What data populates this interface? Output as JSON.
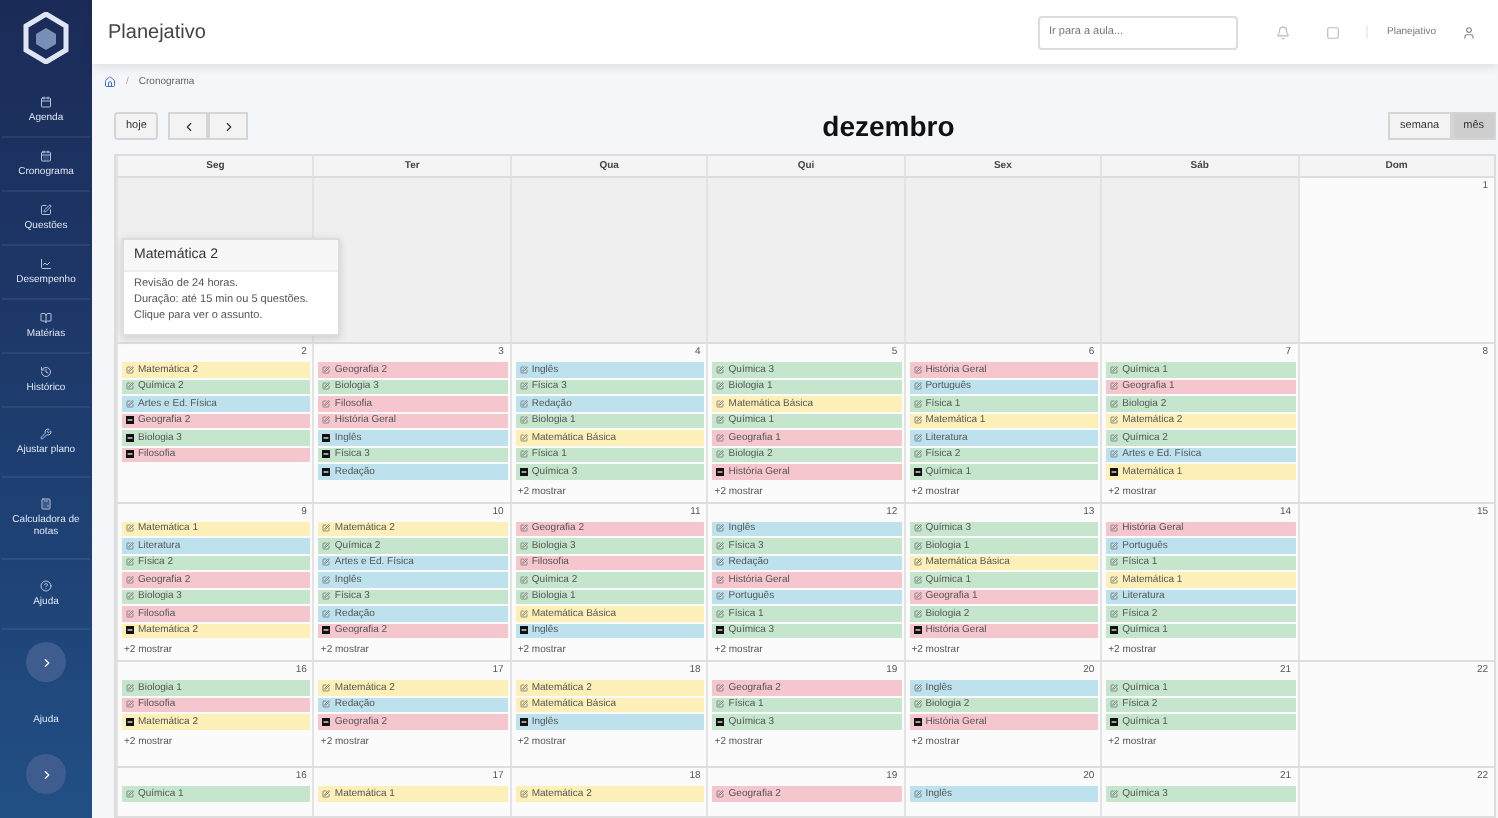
{
  "sidebar": {
    "items": [
      {
        "label": "Agenda",
        "kind": "link"
      },
      {
        "label": "Cronograma",
        "kind": "link"
      },
      {
        "label": "Questões",
        "kind": "link"
      },
      {
        "label": "Desempenho",
        "kind": "link"
      },
      {
        "label": "Matérias",
        "kind": "link"
      },
      {
        "label": "Histórico",
        "kind": "link"
      },
      {
        "label": "Ajustar plano",
        "kind": "link"
      },
      {
        "label": "Calculadora de notas",
        "kind": "link"
      },
      {
        "label": "Ajuda",
        "kind": "link"
      },
      {
        "kind": "toggle"
      },
      {
        "label": "Ajuda",
        "kind": "plain"
      },
      {
        "kind": "toggle"
      }
    ]
  },
  "topbar": {
    "title": "Planejativo",
    "search": {
      "placeholder": "Ir para a aula..."
    },
    "user": "Planejativo"
  },
  "breadcrumb": [
    {
      "kind": "separator",
      "text": "/"
    },
    {
      "kind": "item",
      "text": "Cronograma"
    }
  ],
  "toolbar": {
    "today": "hoje",
    "month": "dezembro",
    "views": [
      {
        "label": "semana",
        "selected": false
      },
      {
        "label": "mês",
        "selected": true
      }
    ]
  },
  "tooltip": {
    "title": "Matemática 2",
    "lines": [
      "Revisão de 24 horas.",
      "Duração: até 15 min ou 5 questões.",
      "Clique para ver o assunto."
    ]
  },
  "calendar": {
    "weekdays": [
      "Seg",
      "Ter",
      "Qua",
      "Qui",
      "Sex",
      "Sáb",
      "Dom"
    ],
    "weeks": [
      {
        "days": [
          {
            "outside": true
          },
          {
            "outside": true
          },
          {
            "outside": true
          },
          {
            "outside": true
          },
          {
            "outside": true
          },
          {
            "outside": true
          },
          {
            "outside": false,
            "date": "1"
          }
        ]
      },
      {
        "days": [
          {
            "outside": false,
            "date": "2",
            "events": [
              {
                "title": "Matemática 2",
                "kind": "pending",
                "color": "#fcefb8"
              },
              {
                "title": "Química 2",
                "kind": "pending",
                "color": "#c5e6cd"
              },
              {
                "title": "Artes e Ed. Física",
                "kind": "pending",
                "color": "#bde2ee"
              },
              {
                "title": "Geografia 2",
                "kind": "done",
                "color": "#f5c6cd"
              },
              {
                "title": "Biologia 3",
                "kind": "done",
                "color": "#c5e6cd"
              },
              {
                "title": "Filosofia",
                "kind": "done",
                "color": "#f5c6cd"
              }
            ]
          },
          {
            "outside": false,
            "date": "3",
            "events": [
              {
                "title": "Geografia 2",
                "kind": "pending",
                "color": "#f5c6cd"
              },
              {
                "title": "Biologia 3",
                "kind": "pending",
                "color": "#c5e6cd"
              },
              {
                "title": "Filosofia",
                "kind": "pending",
                "color": "#f5c6cd"
              },
              {
                "title": "História Geral",
                "kind": "pending",
                "color": "#f5c6cd"
              },
              {
                "title": "Inglês",
                "kind": "done",
                "color": "#bde2ee"
              },
              {
                "title": "Física 3",
                "kind": "done",
                "color": "#c5e6cd"
              },
              {
                "title": "Redação",
                "kind": "done",
                "color": "#bde2ee"
              }
            ]
          },
          {
            "outside": false,
            "date": "4",
            "more": "+2 mostrar",
            "events": [
              {
                "title": "Inglês",
                "kind": "pending",
                "color": "#bde2ee"
              },
              {
                "title": "Física 3",
                "kind": "pending",
                "color": "#c5e6cd"
              },
              {
                "title": "Redação",
                "kind": "pending",
                "color": "#bde2ee"
              },
              {
                "title": "Biologia 1",
                "kind": "pending",
                "color": "#c5e6cd"
              },
              {
                "title": "Matemática Básica",
                "kind": "pending",
                "color": "#fcefb8"
              },
              {
                "title": "Física 1",
                "kind": "pending",
                "color": "#c5e6cd"
              },
              {
                "title": "Química 3",
                "kind": "done",
                "color": "#c5e6cd"
              }
            ]
          },
          {
            "outside": false,
            "date": "5",
            "more": "+2 mostrar",
            "events": [
              {
                "title": "Química 3",
                "kind": "pending",
                "color": "#c5e6cd"
              },
              {
                "title": "Biologia 1",
                "kind": "pending",
                "color": "#c5e6cd"
              },
              {
                "title": "Matemática Básica",
                "kind": "pending",
                "color": "#fcefb8"
              },
              {
                "title": "Química 1",
                "kind": "pending",
                "color": "#c5e6cd"
              },
              {
                "title": "Geografia 1",
                "kind": "pending",
                "color": "#f5c6cd"
              },
              {
                "title": "Biologia 2",
                "kind": "pending",
                "color": "#c5e6cd"
              },
              {
                "title": "História Geral",
                "kind": "done",
                "color": "#f5c6cd"
              }
            ]
          },
          {
            "outside": false,
            "date": "6",
            "more": "+2 mostrar",
            "events": [
              {
                "title": "História Geral",
                "kind": "pending",
                "color": "#f5c6cd"
              },
              {
                "title": "Português",
                "kind": "pending",
                "color": "#bde2ee"
              },
              {
                "title": "Física 1",
                "kind": "pending",
                "color": "#c5e6cd"
              },
              {
                "title": "Matemática 1",
                "kind": "pending",
                "color": "#fcefb8"
              },
              {
                "title": "Literatura",
                "kind": "pending",
                "color": "#bde2ee"
              },
              {
                "title": "Física 2",
                "kind": "pending",
                "color": "#c5e6cd"
              },
              {
                "title": "Química 1",
                "kind": "done",
                "color": "#c5e6cd"
              }
            ]
          },
          {
            "outside": false,
            "date": "7",
            "more": "+2 mostrar",
            "events": [
              {
                "title": "Química 1",
                "kind": "pending",
                "color": "#c5e6cd"
              },
              {
                "title": "Geografia 1",
                "kind": "pending",
                "color": "#f5c6cd"
              },
              {
                "title": "Biologia 2",
                "kind": "pending",
                "color": "#c5e6cd"
              },
              {
                "title": "Matemática 2",
                "kind": "pending",
                "color": "#fcefb8"
              },
              {
                "title": "Química 2",
                "kind": "pending",
                "color": "#c5e6cd"
              },
              {
                "title": "Artes e Ed. Física",
                "kind": "pending",
                "color": "#bde2ee"
              },
              {
                "title": "Matemática 1",
                "kind": "done",
                "color": "#fcefb8"
              }
            ]
          },
          {
            "outside": false,
            "date": "8"
          }
        ]
      },
      {
        "days": [
          {
            "outside": false,
            "date": "9",
            "more": "+2 mostrar",
            "events": [
              {
                "title": "Matemática 1",
                "kind": "pending",
                "color": "#fcefb8"
              },
              {
                "title": "Literatura",
                "kind": "pending",
                "color": "#bde2ee"
              },
              {
                "title": "Física 2",
                "kind": "pending",
                "color": "#c5e6cd"
              },
              {
                "title": "Geografia 2",
                "kind": "pending",
                "color": "#f5c6cd"
              },
              {
                "title": "Biologia 3",
                "kind": "pending",
                "color": "#c5e6cd"
              },
              {
                "title": "Filosofia",
                "kind": "pending",
                "color": "#f5c6cd"
              },
              {
                "title": "Matemática 2",
                "kind": "done",
                "color": "#fcefb8"
              }
            ]
          },
          {
            "outside": false,
            "date": "10",
            "more": "+2 mostrar",
            "events": [
              {
                "title": "Matemática 2",
                "kind": "pending",
                "color": "#fcefb8"
              },
              {
                "title": "Química 2",
                "kind": "pending",
                "color": "#c5e6cd"
              },
              {
                "title": "Artes e Ed. Física",
                "kind": "pending",
                "color": "#bde2ee"
              },
              {
                "title": "Inglês",
                "kind": "pending",
                "color": "#bde2ee"
              },
              {
                "title": "Física 3",
                "kind": "pending",
                "color": "#c5e6cd"
              },
              {
                "title": "Redação",
                "kind": "pending",
                "color": "#bde2ee"
              },
              {
                "title": "Geografia 2",
                "kind": "done",
                "color": "#f5c6cd"
              }
            ]
          },
          {
            "outside": false,
            "date": "11",
            "more": "+2 mostrar",
            "events": [
              {
                "title": "Geografia 2",
                "kind": "pending",
                "color": "#f5c6cd"
              },
              {
                "title": "Biologia 3",
                "kind": "pending",
                "color": "#c5e6cd"
              },
              {
                "title": "Filosofia",
                "kind": "pending",
                "color": "#f5c6cd"
              },
              {
                "title": "Química 2",
                "kind": "pending",
                "color": "#c5e6cd"
              },
              {
                "title": "Biologia 1",
                "kind": "pending",
                "color": "#c5e6cd"
              },
              {
                "title": "Matemática Básica",
                "kind": "pending",
                "color": "#fcefb8"
              },
              {
                "title": "Inglês",
                "kind": "done",
                "color": "#bde2ee"
              }
            ]
          },
          {
            "outside": false,
            "date": "12",
            "more": "+2 mostrar",
            "events": [
              {
                "title": "Inglês",
                "kind": "pending",
                "color": "#bde2ee"
              },
              {
                "title": "Física 3",
                "kind": "pending",
                "color": "#c5e6cd"
              },
              {
                "title": "Redação",
                "kind": "pending",
                "color": "#bde2ee"
              },
              {
                "title": "História Geral",
                "kind": "pending",
                "color": "#f5c6cd"
              },
              {
                "title": "Português",
                "kind": "pending",
                "color": "#bde2ee"
              },
              {
                "title": "Física 1",
                "kind": "pending",
                "color": "#c5e6cd"
              },
              {
                "title": "Química 3",
                "kind": "done",
                "color": "#c5e6cd"
              }
            ]
          },
          {
            "outside": false,
            "date": "13",
            "more": "+2 mostrar",
            "events": [
              {
                "title": "Química 3",
                "kind": "pending",
                "color": "#c5e6cd"
              },
              {
                "title": "Biologia 1",
                "kind": "pending",
                "color": "#c5e6cd"
              },
              {
                "title": "Matemática Básica",
                "kind": "pending",
                "color": "#fcefb8"
              },
              {
                "title": "Química 1",
                "kind": "pending",
                "color": "#c5e6cd"
              },
              {
                "title": "Geografia 1",
                "kind": "pending",
                "color": "#f5c6cd"
              },
              {
                "title": "Biologia 2",
                "kind": "pending",
                "color": "#c5e6cd"
              },
              {
                "title": "História Geral",
                "kind": "done",
                "color": "#f5c6cd"
              }
            ]
          },
          {
            "outside": false,
            "date": "14",
            "more": "+2 mostrar",
            "events": [
              {
                "title": "História Geral",
                "kind": "pending",
                "color": "#f5c6cd"
              },
              {
                "title": "Português",
                "kind": "pending",
                "color": "#bde2ee"
              },
              {
                "title": "Física 1",
                "kind": "pending",
                "color": "#c5e6cd"
              },
              {
                "title": "Matemática 1",
                "kind": "pending",
                "color": "#fcefb8"
              },
              {
                "title": "Literatura",
                "kind": "pending",
                "color": "#bde2ee"
              },
              {
                "title": "Física 2",
                "kind": "pending",
                "color": "#c5e6cd"
              },
              {
                "title": "Química 1",
                "kind": "done",
                "color": "#c5e6cd"
              }
            ]
          },
          {
            "outside": false,
            "date": "15"
          }
        ]
      },
      {
        "days": [
          {
            "outside": false,
            "date": "16",
            "more": "+2 mostrar",
            "events": [
              {
                "title": "Biologia 1",
                "kind": "pending",
                "color": "#c5e6cd"
              },
              {
                "title": "Filosofia",
                "kind": "pending",
                "color": "#f5c6cd"
              },
              {
                "title": "Matemática 2",
                "kind": "done",
                "color": "#fcefb8"
              }
            ]
          },
          {
            "outside": false,
            "date": "17",
            "more": "+2 mostrar",
            "events": [
              {
                "title": "Matemática 2",
                "kind": "pending",
                "color": "#fcefb8"
              },
              {
                "title": "Redação",
                "kind": "pending",
                "color": "#bde2ee"
              },
              {
                "title": "Geografia 2",
                "kind": "done",
                "color": "#f5c6cd"
              }
            ]
          },
          {
            "outside": false,
            "date": "18",
            "more": "+2 mostrar",
            "events": [
              {
                "title": "Matemática 2",
                "kind": "pending",
                "color": "#fcefb8"
              },
              {
                "title": "Matemática Básica",
                "kind": "pending",
                "color": "#fcefb8"
              },
              {
                "title": "Inglês",
                "kind": "done",
                "color": "#bde2ee"
              }
            ]
          },
          {
            "outside": false,
            "date": "19",
            "more": "+2 mostrar",
            "events": [
              {
                "title": "Geografia 2",
                "kind": "pending",
                "color": "#f5c6cd"
              },
              {
                "title": "Física 1",
                "kind": "pending",
                "color": "#c5e6cd"
              },
              {
                "title": "Química 3",
                "kind": "done",
                "color": "#c5e6cd"
              }
            ]
          },
          {
            "outside": false,
            "date": "20",
            "more": "+2 mostrar",
            "events": [
              {
                "title": "Inglês",
                "kind": "pending",
                "color": "#bde2ee"
              },
              {
                "title": "Biologia 2",
                "kind": "pending",
                "color": "#c5e6cd"
              },
              {
                "title": "História Geral",
                "kind": "done",
                "color": "#f5c6cd"
              }
            ]
          },
          {
            "outside": false,
            "date": "21",
            "more": "+2 mostrar",
            "events": [
              {
                "title": "Química 1",
                "kind": "pending",
                "color": "#c5e6cd"
              },
              {
                "title": "Física 2",
                "kind": "pending",
                "color": "#c5e6cd"
              },
              {
                "title": "Química 1",
                "kind": "done",
                "color": "#c5e6cd"
              }
            ]
          },
          {
            "outside": false,
            "date": "22"
          }
        ]
      },
      {
        "days": [
          {
            "outside": false,
            "date": "16",
            "events": [
              {
                "title": "Química 1",
                "kind": "pending",
                "color": "#c5e6cd"
              }
            ]
          },
          {
            "outside": false,
            "date": "17",
            "events": [
              {
                "title": "Matemática 1",
                "kind": "pending",
                "color": "#fcefb8"
              }
            ]
          },
          {
            "outside": false,
            "date": "18",
            "events": [
              {
                "title": "Matemática 2",
                "kind": "pending",
                "color": "#fcefb8"
              }
            ]
          },
          {
            "outside": false,
            "date": "19",
            "events": [
              {
                "title": "Geografia 2",
                "kind": "pending",
                "color": "#f5c6cd"
              }
            ]
          },
          {
            "outside": false,
            "date": "20",
            "events": [
              {
                "title": "Inglês",
                "kind": "pending",
                "color": "#bde2ee"
              }
            ]
          },
          {
            "outside": false,
            "date": "21",
            "events": [
              {
                "title": "Química 3",
                "kind": "pending",
                "color": "#c5e6cd"
              }
            ]
          },
          {
            "outside": false,
            "date": "22"
          }
        ]
      }
    ]
  }
}
